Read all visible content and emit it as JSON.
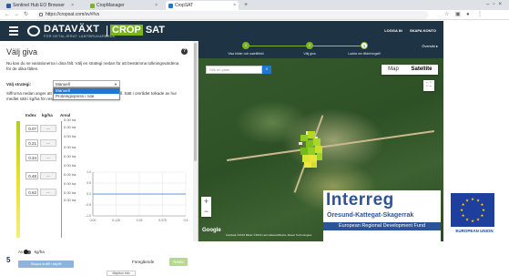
{
  "browser": {
    "tabs": [
      {
        "label": "Sentinel Hub EO Browser",
        "active": false
      },
      {
        "label": "CropManager",
        "active": false
      },
      {
        "label": "CropSAT",
        "active": true
      }
    ],
    "url": "https://cropsat.com/sv/#/vs",
    "new_tab": "+"
  },
  "app": {
    "brand": "DATAVÄXT",
    "brand_tagline": "FÖR DETALJERAT LANTBRUKARBRUK",
    "product_crop": "CROP",
    "product_sat": "SAT",
    "login": "LOGGA IN",
    "create_account": "SKAPA KONTO"
  },
  "panel": {
    "title": "Välj giva",
    "intro": "Nu kan du se variationerna i dina fält. Välj en strategi nedan för att bestämma tolkningsvärdena för de olika fälten.",
    "strategy_label": "Välj strategi:",
    "strategy_value": "Manuell",
    "strategy_options": [
      "Manuell",
      "Proteingivpress i rute"
    ],
    "description": "Siffrorna nedan anger att de olika intervall i NDVI-vinter/Intervall. Sätt i området tolkade av hur medlet sätt i kg/ha för respektive intervall.",
    "columns": {
      "index": "Index",
      "kgha": "kg/ha",
      "area": "Areal"
    },
    "rows": [
      {
        "index": "0.07",
        "area": "0.00 ha"
      },
      {
        "index": "0.21",
        "area": "0.00 ha"
      },
      {
        "index": "0.34",
        "area": "0.00 ha"
      },
      {
        "index": "0.48",
        "area": "0.00 ha"
      },
      {
        "index": "0.62",
        "area": "0.00 ha"
      }
    ],
    "row_button": "—",
    "extra_areas": [
      "0.00 ha",
      "0.00 ha",
      "0.00 ha",
      "0.00 ha",
      "0.00 ha",
      "0.00 ha"
    ],
    "toggle_off": "Av",
    "toggle_on": "kg/ha",
    "create_button": "Skapa ordfil / styrfil",
    "prev_button": "Föregående",
    "next_button": "Nästa",
    "mapbox_link": "Mapbox info",
    "slide_number": "5"
  },
  "chart_data": {
    "type": "line",
    "x": [
      0,
      0.125,
      0.25,
      0.375,
      0.5
    ],
    "x_tick_labels": [
      "0.00",
      "0.125",
      "0.25",
      "0.375",
      "0.5"
    ],
    "y_tick_labels": [
      "1.0",
      "0.5",
      "0.0",
      "-0.5",
      "-1.0"
    ],
    "series": [
      {
        "values": [
          0,
          0,
          0,
          0,
          0
        ]
      }
    ],
    "ylim": [
      -1,
      1
    ],
    "grid": true
  },
  "stepper": {
    "steps": [
      {
        "number": "1",
        "label": "Visa bilder och satellitbild"
      },
      {
        "number": "2",
        "label": "Välj giva"
      },
      {
        "number": "3",
        "label": "Ladda ner tilldelningsfil"
      }
    ],
    "forward": "Översikt ▸"
  },
  "map": {
    "search_placeholder": "Sök en plats",
    "type_map": "Map",
    "type_satellite": "Satellite",
    "zoom_in": "+",
    "zoom_out": "−",
    "google": "Google",
    "attribution": "Kartdata ©2019 Bilder ©2019 Lantmäteriet/Metria, Maxar Technologies"
  },
  "logos": {
    "interreg": "Interreg",
    "interreg_region": "Öresund-Kattegat-Skagerrak",
    "interreg_fund": "European Regional Development Fund",
    "eu": "EUROPEAN UNION"
  },
  "colors": {
    "header": "#1e3445",
    "accent": "#7ab51d",
    "interreg_blue": "#2d5496",
    "eu_blue": "#1f3f9e",
    "eu_star": "#ffd200"
  },
  "icons": {
    "menu": "menu-icon",
    "help": "help-icon",
    "search": "search-icon",
    "fullscreen": "fullscreen-icon",
    "lock": "lock-icon"
  }
}
